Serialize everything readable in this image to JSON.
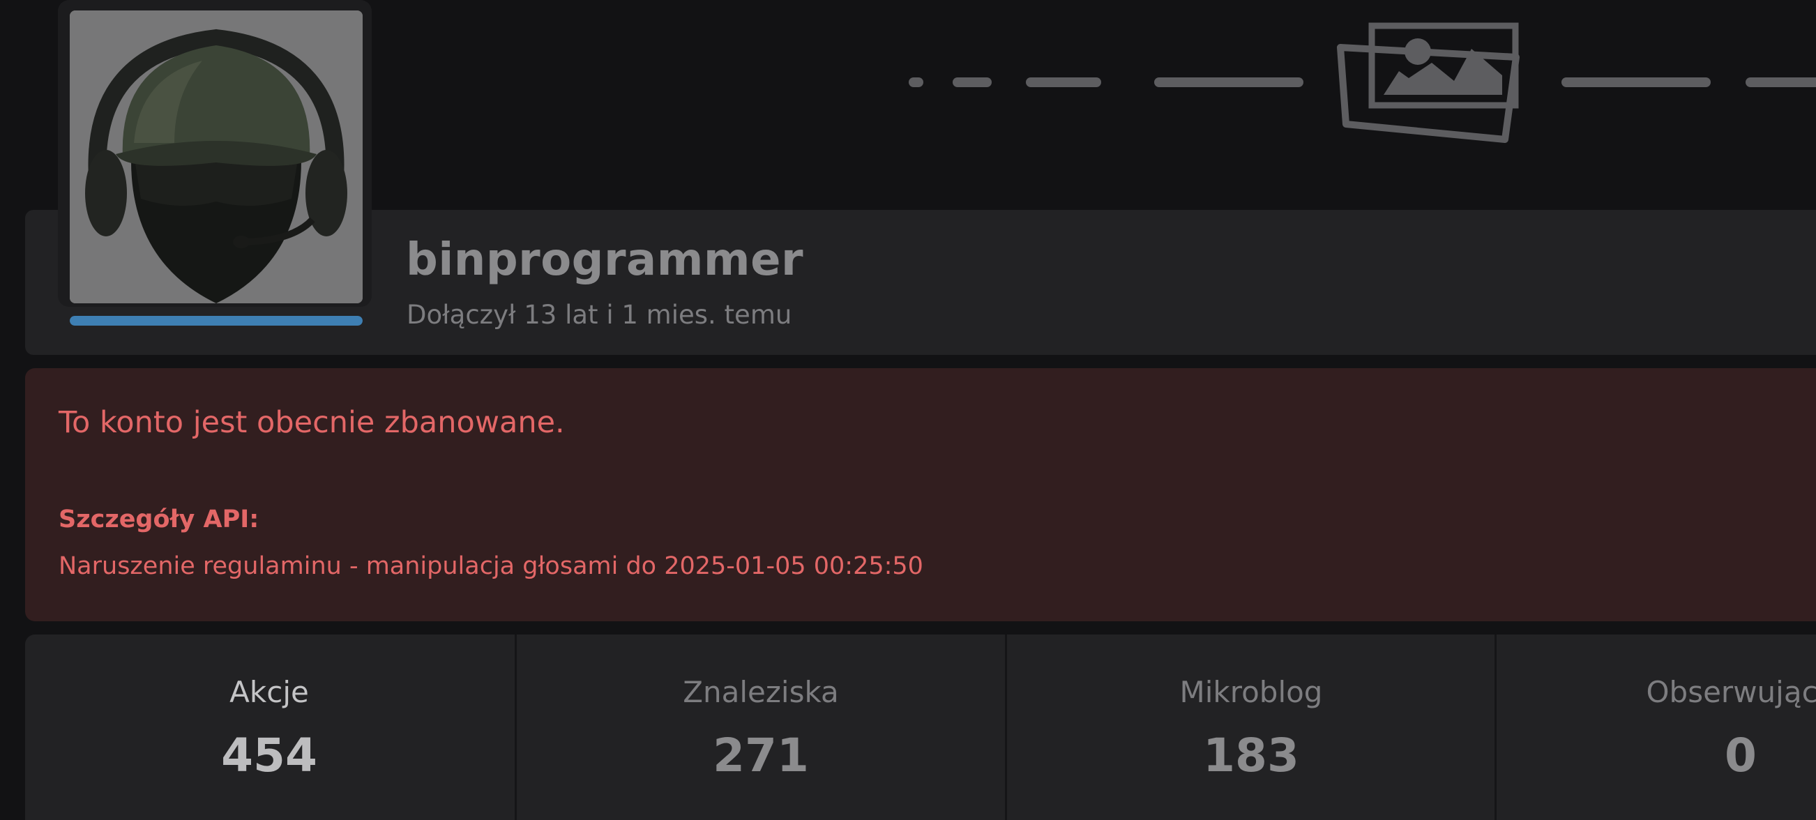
{
  "cover": {
    "icon": "image-placeholder-icon"
  },
  "profile": {
    "username": "binprogrammer",
    "joined": "Dołączył 13 lat i 1 mies. temu",
    "avatar_icon": "avatar-icon",
    "level_progress": 1.0,
    "level_color": "#3e7fb3"
  },
  "ban": {
    "title": "To konto jest obecnie zbanowane.",
    "details_label": "Szczegóły API:",
    "reason": "Naruszenie regulaminu - manipulacja głosami do 2025-01-05 00:25:50",
    "color": "#e36767"
  },
  "stats": {
    "items": [
      {
        "label": "Akcje",
        "value": "454",
        "active": true
      },
      {
        "label": "Znaleziska",
        "value": "271",
        "active": false
      },
      {
        "label": "Mikroblog",
        "value": "183",
        "active": false
      },
      {
        "label": "Obserwujący",
        "value": "0",
        "active": false
      }
    ]
  }
}
